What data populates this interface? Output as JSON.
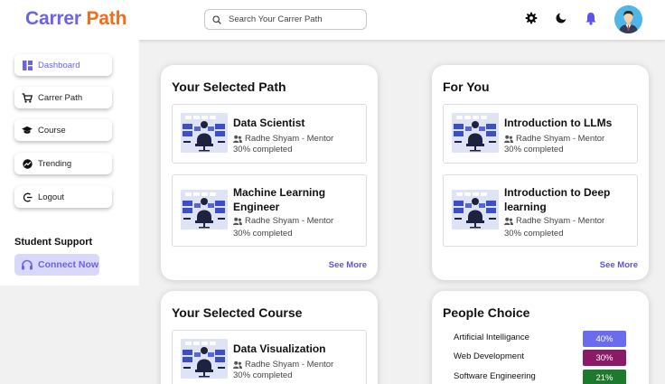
{
  "header": {
    "logo_part1": "Carrer",
    "logo_part2": "Path",
    "search_placeholder": "Search Your Carrer Path",
    "icons": [
      "gear-icon",
      "moon-icon",
      "bell-icon",
      "avatar"
    ]
  },
  "sidebar": {
    "items": [
      {
        "label": "Dashboard",
        "icon": "dashboard-icon",
        "active": true
      },
      {
        "label": "Carrer Path",
        "icon": "cart-icon"
      },
      {
        "label": "Course",
        "icon": "graduation-cap-icon"
      },
      {
        "label": "Trending",
        "icon": "trending-icon"
      },
      {
        "label": "Logout",
        "icon": "logout-icon"
      }
    ],
    "support_title": "Student Support",
    "connect_label": "Connect Now"
  },
  "selected_path": {
    "title": "Your Selected Path",
    "items": [
      {
        "title": "Data Scientist",
        "mentor": "Radhe Shyam - Mentor",
        "progress": "30% completed"
      },
      {
        "title": "Machine Learning Engineer",
        "mentor": "Radhe Shyam - Mentor",
        "progress": "30% completed"
      }
    ],
    "see_more": "See More"
  },
  "for_you": {
    "title": "For You",
    "items": [
      {
        "title": "Introduction to LLMs",
        "mentor": "Radhe Shyam - Mentor",
        "progress": "30% completed"
      },
      {
        "title": "Introduction to Deep learning",
        "mentor": "Radhe Shyam - Mentor",
        "progress": "30% completed"
      }
    ],
    "see_more": "See More"
  },
  "selected_course": {
    "title": "Your Selected Course",
    "items": [
      {
        "title": "Data Visualization",
        "mentor": "Radhe Shyam - Mentor",
        "progress": "30% completed"
      }
    ]
  },
  "people_choice": {
    "title": "People Choice",
    "items": [
      {
        "label": "Artificial Intelligance",
        "value": "40%",
        "color": "#6b6bf0"
      },
      {
        "label": "Web Development",
        "value": "30%",
        "color": "#8b1a66"
      },
      {
        "label": "Software Engineering",
        "value": "21%",
        "color": "#1d7a2c"
      }
    ]
  },
  "colors": {
    "brand_primary": "#6b63e9",
    "brand_secondary": "#f46b1a",
    "link": "#5b55d6"
  }
}
